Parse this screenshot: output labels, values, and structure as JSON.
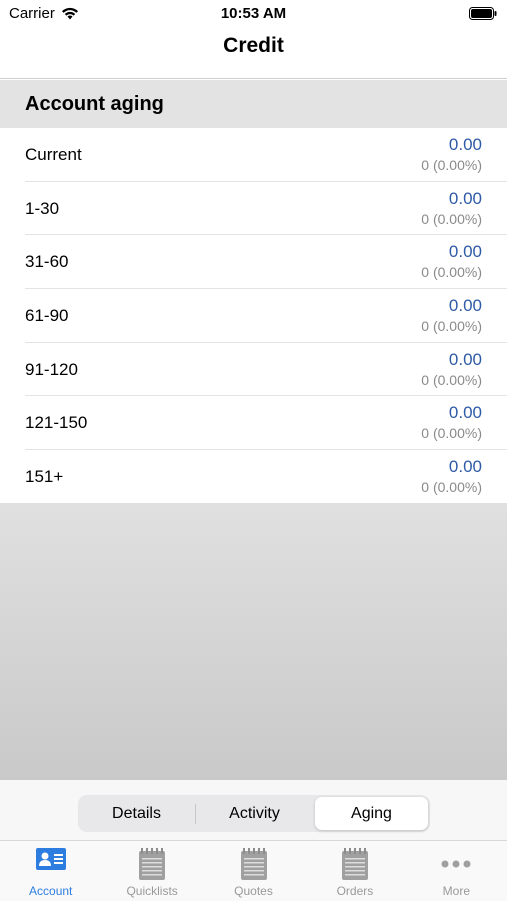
{
  "status_bar": {
    "carrier": "Carrier",
    "time": "10:53 AM"
  },
  "nav": {
    "title": "Credit"
  },
  "section": {
    "title": "Account aging"
  },
  "aging_rows": [
    {
      "label": "Current",
      "amount": "0.00",
      "detail": "0 (0.00%)"
    },
    {
      "label": "1-30",
      "amount": "0.00",
      "detail": "0 (0.00%)"
    },
    {
      "label": "31-60",
      "amount": "0.00",
      "detail": "0 (0.00%)"
    },
    {
      "label": "61-90",
      "amount": "0.00",
      "detail": "0 (0.00%)"
    },
    {
      "label": "91-120",
      "amount": "0.00",
      "detail": "0 (0.00%)"
    },
    {
      "label": "121-150",
      "amount": "0.00",
      "detail": "0 (0.00%)"
    },
    {
      "label": "151+",
      "amount": "0.00",
      "detail": "0 (0.00%)"
    }
  ],
  "segments": {
    "items": [
      "Details",
      "Activity",
      "Aging"
    ],
    "selected": "Aging"
  },
  "tabs": [
    {
      "label": "Account",
      "icon": "account-card-icon",
      "active": true
    },
    {
      "label": "Quicklists",
      "icon": "notepad-icon",
      "active": false
    },
    {
      "label": "Quotes",
      "icon": "notepad-icon",
      "active": false
    },
    {
      "label": "Orders",
      "icon": "notepad-icon",
      "active": false
    },
    {
      "label": "More",
      "icon": "ellipsis-icon",
      "active": false
    }
  ],
  "colors": {
    "accent": "#2d7de0",
    "amount": "#2e5aa6",
    "inactive": "#999999"
  }
}
